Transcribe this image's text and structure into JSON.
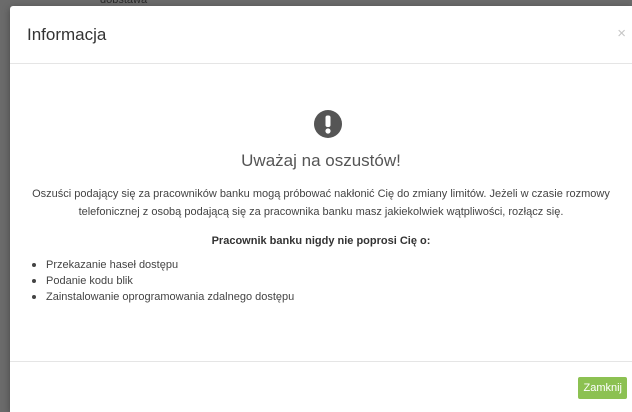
{
  "background": {
    "partial_text": "dobstawa"
  },
  "modal": {
    "title": "Informacja",
    "close_symbol": "×",
    "icon": "exclamation-circle-icon",
    "headline": "Uważaj na oszustów!",
    "description": "Oszuści podający się za pracowników banku mogą próbować nakłonić Cię do zmiany limitów. Jeżeli w czasie rozmowy telefonicznej z osobą podającą się za pracownika banku masz jakiekolwiek wątpliwości, rozłącz się.",
    "bold_line": "Pracownik banku nigdy nie poprosi Cię o:",
    "list_items": [
      "Przekazanie haseł dostępu",
      "Podanie kodu blik",
      "Zainstalowanie oprogramowania zdalnego dostępu"
    ],
    "footer_button": "Zamknij"
  },
  "colors": {
    "icon_color": "#555555",
    "button_bg": "#8cc152",
    "button_text": "#ffffff",
    "overlay": "#6b6b6b"
  }
}
